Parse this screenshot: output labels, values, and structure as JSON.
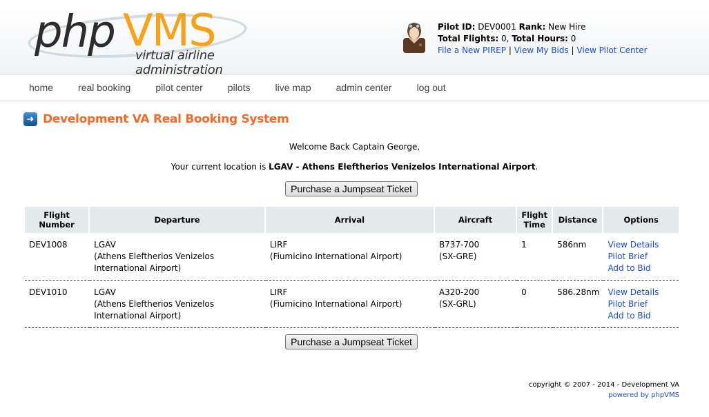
{
  "header": {
    "logo_main_left": "php",
    "logo_main_right": "VMS",
    "logo_subtitle": "virtual airline administration",
    "pilot": {
      "pilot_id_label": "Pilot ID:",
      "pilot_id": "DEV0001",
      "rank_label": "Rank:",
      "rank": "New Hire",
      "total_flights_label": "Total Flights:",
      "total_flights": "0,",
      "total_hours_label": "Total Hours:",
      "total_hours": "0",
      "links": [
        "File a New PIREP",
        "View My Bids",
        "View Pilot Center"
      ],
      "separator": "|"
    }
  },
  "nav": {
    "items": [
      "home",
      "real booking",
      "pilot center",
      "pilots",
      "live map",
      "admin center",
      "log out"
    ]
  },
  "page": {
    "title": "Development VA Real Booking System",
    "title_icon": "arrow-right-icon",
    "welcome": "Welcome Back Captain George,",
    "location_prefix": "Your current location is ",
    "location_value": "LGAV - Athens Eleftherios Venizelos International Airport",
    "location_suffix": ".",
    "jumpseat_button": "Purchase a Jumpseat Ticket"
  },
  "table": {
    "headers": [
      "Flight Number",
      "Departure",
      "Arrival",
      "Aircraft",
      "Flight Time",
      "Distance",
      "Options"
    ],
    "rows": [
      {
        "flight_number": "DEV1008",
        "dep_code": "LGAV",
        "dep_name": "(Athens Eleftherios Venizelos International Airport)",
        "arr_code": "LIRF",
        "arr_name": "(Fiumicino International Airport)",
        "aircraft": "B737-700",
        "registration": "(SX-GRE)",
        "flight_time": "1",
        "distance": "586nm",
        "options": [
          "View Details",
          "Pilot Brief",
          "Add to Bid"
        ]
      },
      {
        "flight_number": "DEV1010",
        "dep_code": "LGAV",
        "dep_name": "(Athens Eleftherios Venizelos International Airport)",
        "arr_code": "LIRF",
        "arr_name": "(Fiumicino International Airport)",
        "aircraft": "A320-200",
        "registration": "(SX-GRL)",
        "flight_time": "0",
        "distance": "586.28nm",
        "options": [
          "View Details",
          "Pilot Brief",
          "Add to Bid"
        ]
      }
    ]
  },
  "footer": {
    "copyright": "copyright © 2007 - 2014 - Development VA",
    "powered_by": "powered by phpVMS"
  },
  "colors": {
    "title_accent": "#f26b2a",
    "logo_orange": "#f7a21b",
    "link": "#1a4bd6",
    "table_header_bg": "#e3eaeb"
  }
}
